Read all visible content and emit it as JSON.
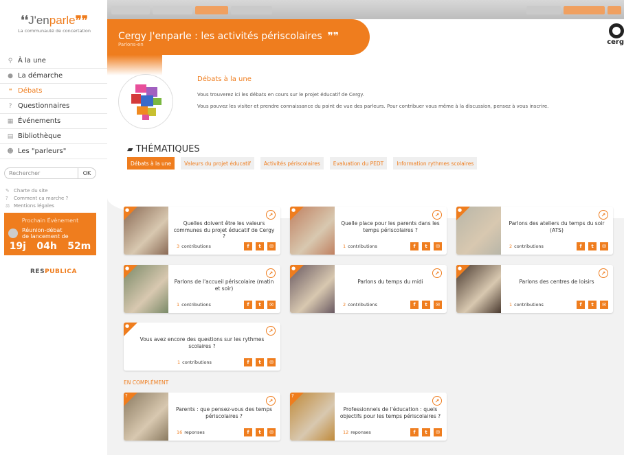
{
  "logo": {
    "quote_open": "❛❛",
    "name_a": "J'en",
    "name_b": "parle",
    "quote_close": "❞❞",
    "tagline": "La communauté de concertation"
  },
  "nav": [
    {
      "icon": "pin-icon",
      "glyph": "⚲",
      "label": "À la une",
      "active": false
    },
    {
      "icon": "info-icon",
      "glyph": "●",
      "label": "La démarche",
      "active": false
    },
    {
      "icon": "chat-icon",
      "glyph": "❝",
      "label": "Débats",
      "active": true
    },
    {
      "icon": "question-icon",
      "glyph": "?",
      "label": "Questionnaires",
      "active": false
    },
    {
      "icon": "calendar-icon",
      "glyph": "▦",
      "label": "Événements",
      "active": false
    },
    {
      "icon": "book-icon",
      "glyph": "▤",
      "label": "Bibliothèque",
      "active": false
    },
    {
      "icon": "users-icon",
      "glyph": "☻",
      "label": "Les \"parleurs\"",
      "active": false
    }
  ],
  "search": {
    "placeholder": "Rechercher",
    "button": "OK"
  },
  "footer_links": [
    {
      "glyph": "✎",
      "label": "Charte du site"
    },
    {
      "glyph": "?",
      "label": "Comment ca marche ?"
    },
    {
      "glyph": "⚖",
      "label": "Mentions légales"
    }
  ],
  "event": {
    "heading": "Prochain Évènement",
    "title_l1": "Réunion-débat",
    "title_l2": "de lancement de",
    "days": "19j",
    "hours": "04h",
    "mins": "52m"
  },
  "sponsor": {
    "a": "RES",
    "b": "PUBLICA"
  },
  "banner": {
    "title": "Cergy J'enparle : les activités périscolaires",
    "quote": "❞❞",
    "subtitle": "Parlons-en"
  },
  "brand": {
    "name": "cerg"
  },
  "intro": {
    "title": "Débats à la une",
    "p1": "Vous trouverez ici les débats en cours sur le projet éducatif de Cergy.",
    "p2": "Vous pouvez les visiter et prendre connaissance du point de vue des parleurs. Pour contribuer vous même à la discussion, pensez à vous inscrire."
  },
  "thematiques": {
    "heading": "THÉMATIQUES",
    "tabs": [
      {
        "label": "Débats à la une",
        "active": true
      },
      {
        "label": "Valeurs du projet éducatif"
      },
      {
        "label": "Activités périscolaires"
      },
      {
        "label": "Evaluation du PEDT"
      },
      {
        "label": "Information rythmes scolaires"
      }
    ]
  },
  "debates": [
    {
      "title": "Quelles doivent être les valeurs communes du projet éducatif de Cergy ?",
      "count": "3",
      "count_label": "contributions",
      "img": "#8a6a55"
    },
    {
      "title": "Quelle place pour les parents dans les temps périscolaires ?",
      "count": "1",
      "count_label": "contributions",
      "img": "#c08060"
    },
    {
      "title": "Parlons des ateliers du temps du soir (ATS)",
      "count": "2",
      "count_label": "contributions",
      "img": "#b8b6a8"
    },
    {
      "title": "Parlons de l'accueil périscolaire (matin et soir)",
      "count": "1",
      "count_label": "contributions",
      "img": "#7a8a68"
    },
    {
      "title": "Parlons du temps du midi",
      "count": "2",
      "count_label": "contributions",
      "img": "#6a5a62"
    },
    {
      "title": "Parlons des centres de loisirs",
      "count": "1",
      "count_label": "contributions",
      "img": "#4a3a30"
    },
    {
      "title": "Vous avez encore des questions sur les rythmes scolaires ?",
      "count": "1",
      "count_label": "contributions",
      "img": ""
    }
  ],
  "complement": {
    "heading": "EN COMPLÉMENT",
    "items": [
      {
        "title": "Parents : que pensez-vous des temps périscolaires ?",
        "count": "16",
        "count_label": "reponses",
        "img": "#8a7a60"
      },
      {
        "title": "Professionnels de l'éducation : quels objectifs pour les temps périscolaires ?",
        "count": "12",
        "count_label": "reponses",
        "img": "#c08a3a"
      }
    ]
  },
  "social": {
    "facebook": "f",
    "twitter": "t",
    "email": "✉"
  },
  "colors": {
    "accent": "#ef7d1e",
    "bg": "#f2f2f2"
  }
}
